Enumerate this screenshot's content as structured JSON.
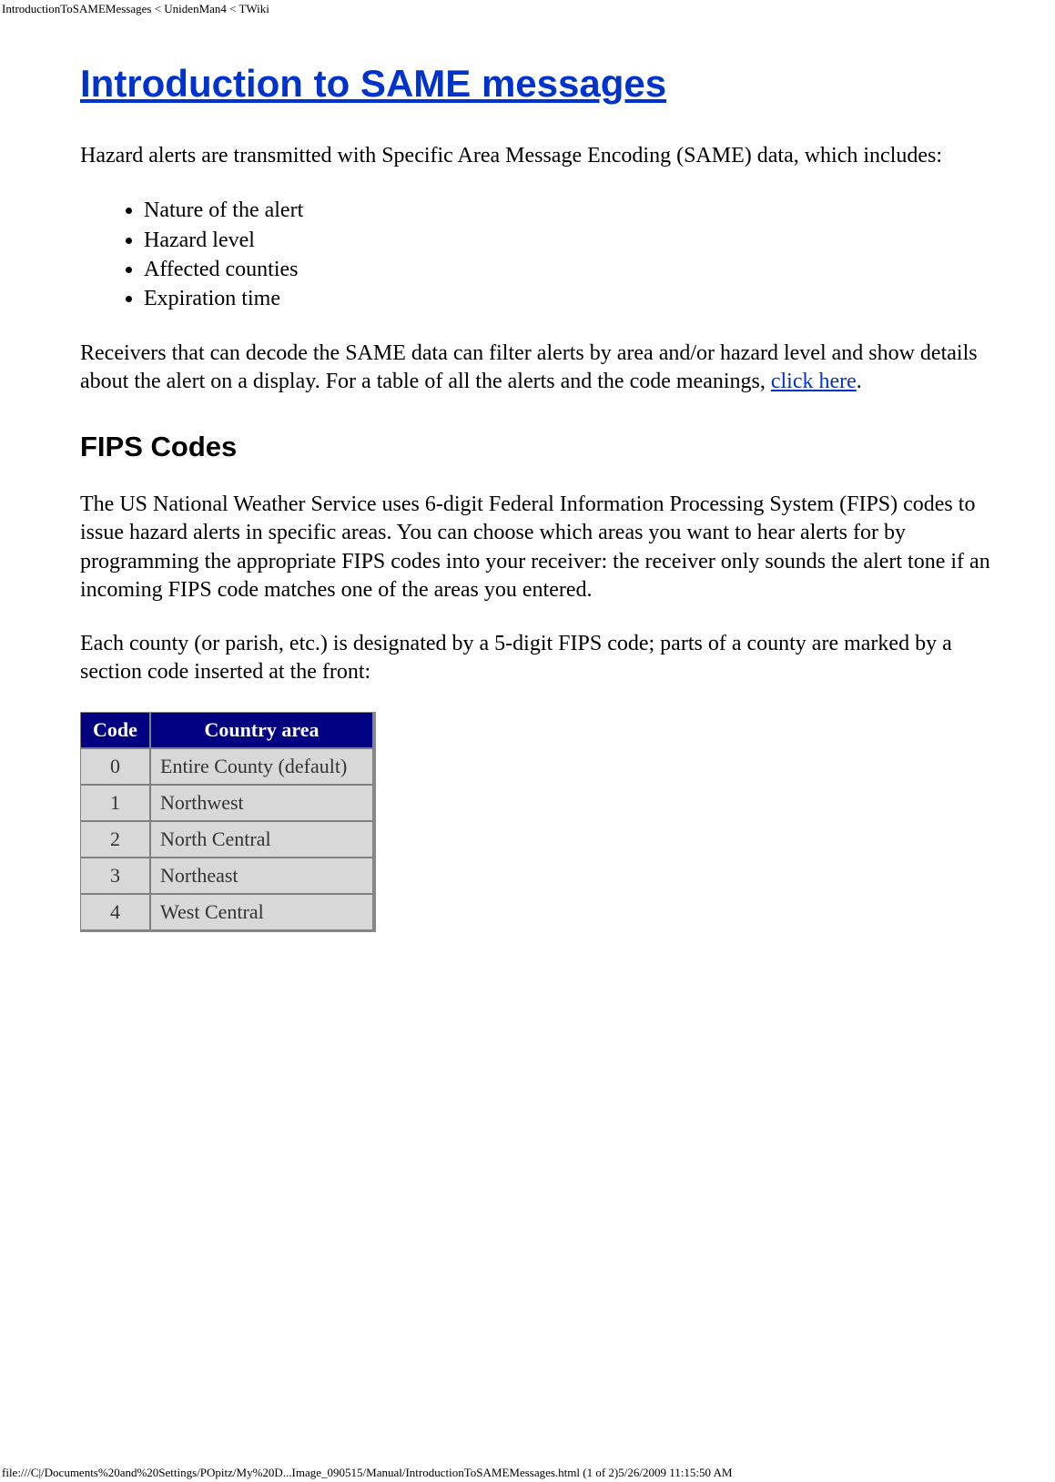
{
  "header": {
    "breadcrumb": "IntroductionToSAMEMessages < UnidenMan4 < TWiki"
  },
  "main": {
    "title": "Introduction to SAME messages",
    "intro_paragraph": "Hazard alerts are transmitted with Specific Area Message Encoding (SAME) data, which includes:",
    "bullets": [
      "Nature of the alert",
      "Hazard level",
      "Affected counties",
      "Expiration time"
    ],
    "receivers_text_before_link": "Receivers that can decode the SAME data can filter alerts by area and/or hazard level and show details about the alert on a display. For a table of all the alerts and the code meanings, ",
    "receivers_link_text": "click here",
    "receivers_text_after_link": ".",
    "fips_heading": "FIPS Codes",
    "fips_paragraph_1": "The US National Weather Service uses 6-digit Federal Information Processing System (FIPS) codes to issue hazard alerts in specific areas. You can choose which areas you want to hear alerts for by programming the appropriate FIPS codes into your receiver: the receiver only sounds the alert tone if an incoming FIPS code matches one of the areas you entered.",
    "fips_paragraph_2": "Each county (or parish, etc.) is designated by a 5-digit FIPS code; parts of a county are marked by a section code inserted at the front:",
    "table": {
      "header_code": "Code",
      "header_area": "Country area",
      "rows": [
        {
          "code": "0",
          "area": "Entire County (default)"
        },
        {
          "code": "1",
          "area": "Northwest"
        },
        {
          "code": "2",
          "area": "North Central"
        },
        {
          "code": "3",
          "area": "Northeast"
        },
        {
          "code": "4",
          "area": "West Central"
        }
      ]
    }
  },
  "footer": {
    "text": "file:///C|/Documents%20and%20Settings/POpitz/My%20D...Image_090515/Manual/IntroductionToSAMEMessages.html (1 of 2)5/26/2009 11:15:50 AM"
  }
}
